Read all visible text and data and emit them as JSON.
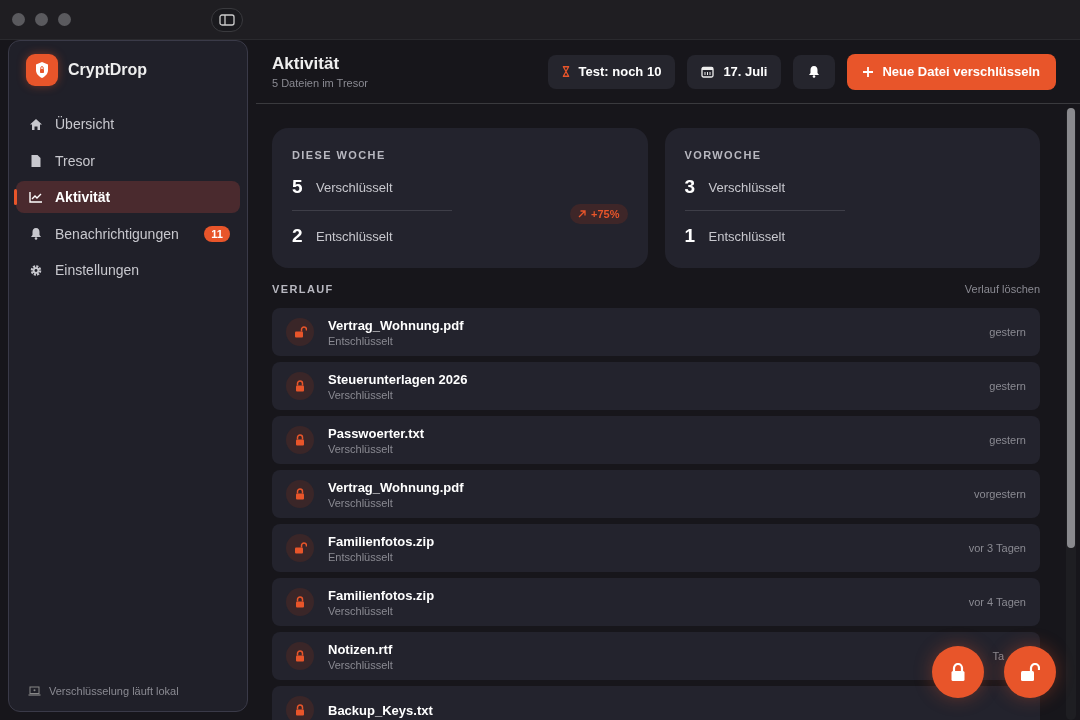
{
  "app": {
    "name": "CryptDrop"
  },
  "sidebar": {
    "items": [
      {
        "label": "Übersicht",
        "selected": false
      },
      {
        "label": "Tresor",
        "selected": false
      },
      {
        "label": "Aktivität",
        "selected": true
      },
      {
        "label": "Benachrichtigungen",
        "selected": false,
        "badge": "11"
      },
      {
        "label": "Einstellungen",
        "selected": false
      }
    ],
    "footer": "Verschlüsselung läuft lokal"
  },
  "header": {
    "title": "Aktivität",
    "subtitle": "5 Dateien im Tresor",
    "trial": "Test: noch 10",
    "date": "17. Juli",
    "primary_button": "Neue Datei verschlüsseln"
  },
  "stats": [
    {
      "title": "DIESE WOCHE",
      "rows": [
        {
          "number": "5",
          "label": "Verschlüsselt"
        },
        {
          "number": "2",
          "label": "Entschlüsselt"
        }
      ],
      "trend": "+75%"
    },
    {
      "title": "VORWOCHE",
      "rows": [
        {
          "number": "3",
          "label": "Verschlüsselt"
        },
        {
          "number": "1",
          "label": "Entschlüsselt"
        }
      ]
    }
  ],
  "history": {
    "title": "VERLAUF",
    "clear": "Verlauf löschen",
    "items": [
      {
        "name": "Vertrag_Wohnung.pdf",
        "status": "Entschlüsselt",
        "locked": false,
        "time": "gestern"
      },
      {
        "name": "Steuerunterlagen 2026",
        "status": "Verschlüsselt",
        "locked": true,
        "time": "gestern"
      },
      {
        "name": "Passwoerter.txt",
        "status": "Verschlüsselt",
        "locked": true,
        "time": "gestern"
      },
      {
        "name": "Vertrag_Wohnung.pdf",
        "status": "Verschlüsselt",
        "locked": true,
        "time": "vorgestern"
      },
      {
        "name": "Familienfotos.zip",
        "status": "Entschlüsselt",
        "locked": false,
        "time": "vor 3 Tagen"
      },
      {
        "name": "Familienfotos.zip",
        "status": "Verschlüsselt",
        "locked": true,
        "time": "vor 4 Tagen"
      },
      {
        "name": "Notizen.rtf",
        "status": "Verschlüsselt",
        "locked": true,
        "time": "Ta",
        "covered": true
      },
      {
        "name": "Backup_Keys.txt",
        "locked": true
      }
    ]
  }
}
